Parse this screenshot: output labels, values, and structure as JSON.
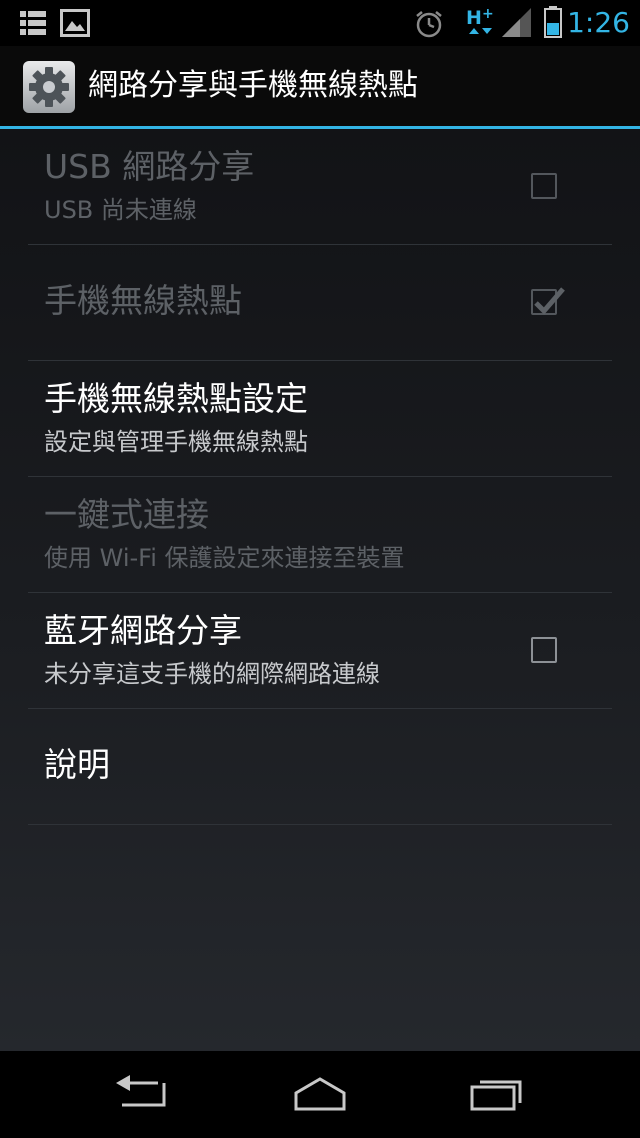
{
  "status_bar": {
    "time": "1:26",
    "icons": [
      "notification-list-icon",
      "gallery-icon",
      "alarm-icon",
      "hspa-plus-data-icon",
      "signal-icon",
      "battery-icon"
    ]
  },
  "action_bar": {
    "title": "網路分享與手機無線熱點",
    "icon": "settings-gear-icon"
  },
  "preferences": [
    {
      "title": "USB 網路分享",
      "summary": "USB 尚未連線",
      "enabled": false,
      "widget": "checkbox",
      "checked": false
    },
    {
      "title": "手機無線熱點",
      "summary": "",
      "enabled": false,
      "widget": "checkbox",
      "checked": true
    },
    {
      "title": "手機無線熱點設定",
      "summary": "設定與管理手機無線熱點",
      "enabled": true,
      "widget": "none"
    },
    {
      "title": "一鍵式連接",
      "summary": "使用 Wi-Fi 保護設定來連接至裝置",
      "enabled": false,
      "widget": "none"
    },
    {
      "title": "藍牙網路分享",
      "summary": "未分享這支手機的網際網路連線",
      "enabled": true,
      "widget": "checkbox",
      "checked": false
    },
    {
      "title": "說明",
      "summary": "",
      "enabled": true,
      "widget": "none"
    }
  ],
  "nav_bar": {
    "buttons": [
      "back-icon",
      "home-icon",
      "recent-apps-icon"
    ]
  },
  "colors": {
    "accent": "#33b5e5",
    "background": "#000000"
  }
}
